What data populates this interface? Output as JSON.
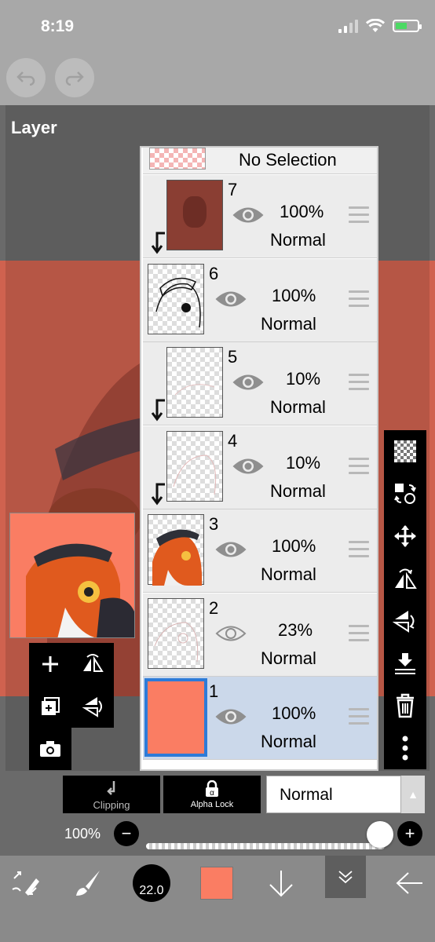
{
  "status": {
    "time": "8:19"
  },
  "panel": {
    "title": "Layer"
  },
  "layers": {
    "no_selection_label": "No Selection",
    "rows": [
      {
        "number": "7",
        "opacity": "100%",
        "blend": "Normal",
        "visible": true,
        "clipped": true
      },
      {
        "number": "6",
        "opacity": "100%",
        "blend": "Normal",
        "visible": true,
        "clipped": false
      },
      {
        "number": "5",
        "opacity": "10%",
        "blend": "Normal",
        "visible": true,
        "clipped": true
      },
      {
        "number": "4",
        "opacity": "10%",
        "blend": "Normal",
        "visible": true,
        "clipped": true
      },
      {
        "number": "3",
        "opacity": "100%",
        "blend": "Normal",
        "visible": true,
        "clipped": false
      },
      {
        "number": "2",
        "opacity": "23%",
        "blend": "Normal",
        "visible": true,
        "clipped": false
      },
      {
        "number": "1",
        "opacity": "100%",
        "blend": "Normal",
        "visible": true,
        "clipped": false,
        "selected": true
      }
    ]
  },
  "controls": {
    "clipping_label": "Clipping",
    "alpha_lock_label": "Alpha Lock",
    "blend_mode": "Normal",
    "opacity_label": "100%",
    "opacity_value": 1.0
  },
  "toolbar": {
    "brush_size": "22.0",
    "color": "#fa7d63"
  },
  "colors": {
    "canvas_bg": "#d0624f",
    "selected_layer": "#cbd8ea",
    "accent_blue": "#2d7bd8"
  }
}
